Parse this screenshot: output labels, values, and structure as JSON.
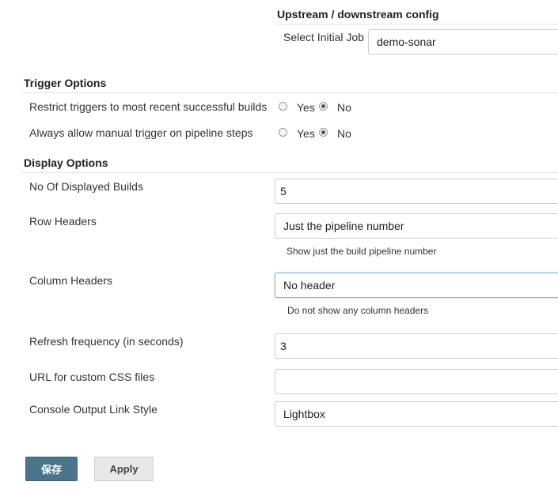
{
  "upstream": {
    "title": "Upstream / downstream config",
    "select_initial_job_label": "Select Initial Job",
    "select_initial_job_value": "demo-sonar"
  },
  "trigger_options": {
    "title": "Trigger Options",
    "restrict": {
      "label": "Restrict triggers to most recent successful builds",
      "yes": "Yes",
      "no": "No",
      "selected": "No"
    },
    "manual": {
      "label": "Always allow manual trigger on pipeline steps",
      "yes": "Yes",
      "no": "No",
      "selected": "No"
    }
  },
  "display_options": {
    "title": "Display Options",
    "displayed_builds": {
      "label": "No Of Displayed Builds",
      "value": "5"
    },
    "row_headers": {
      "label": "Row Headers",
      "value": "Just the pipeline number",
      "hint": "Show just the build pipeline number"
    },
    "column_headers": {
      "label": "Column Headers",
      "value": "No header",
      "hint": "Do not show any column headers"
    },
    "refresh_frequency": {
      "label": "Refresh frequency (in seconds)",
      "value": "3"
    },
    "custom_css": {
      "label": "URL for custom CSS files",
      "value": ""
    },
    "console_link_style": {
      "label": "Console Output Link Style",
      "value": "Lightbox"
    }
  },
  "buttons": {
    "save": "保存",
    "apply": "Apply"
  },
  "colors": {
    "primary_button": "#4b758b",
    "focus_border": "#8db0d8"
  }
}
